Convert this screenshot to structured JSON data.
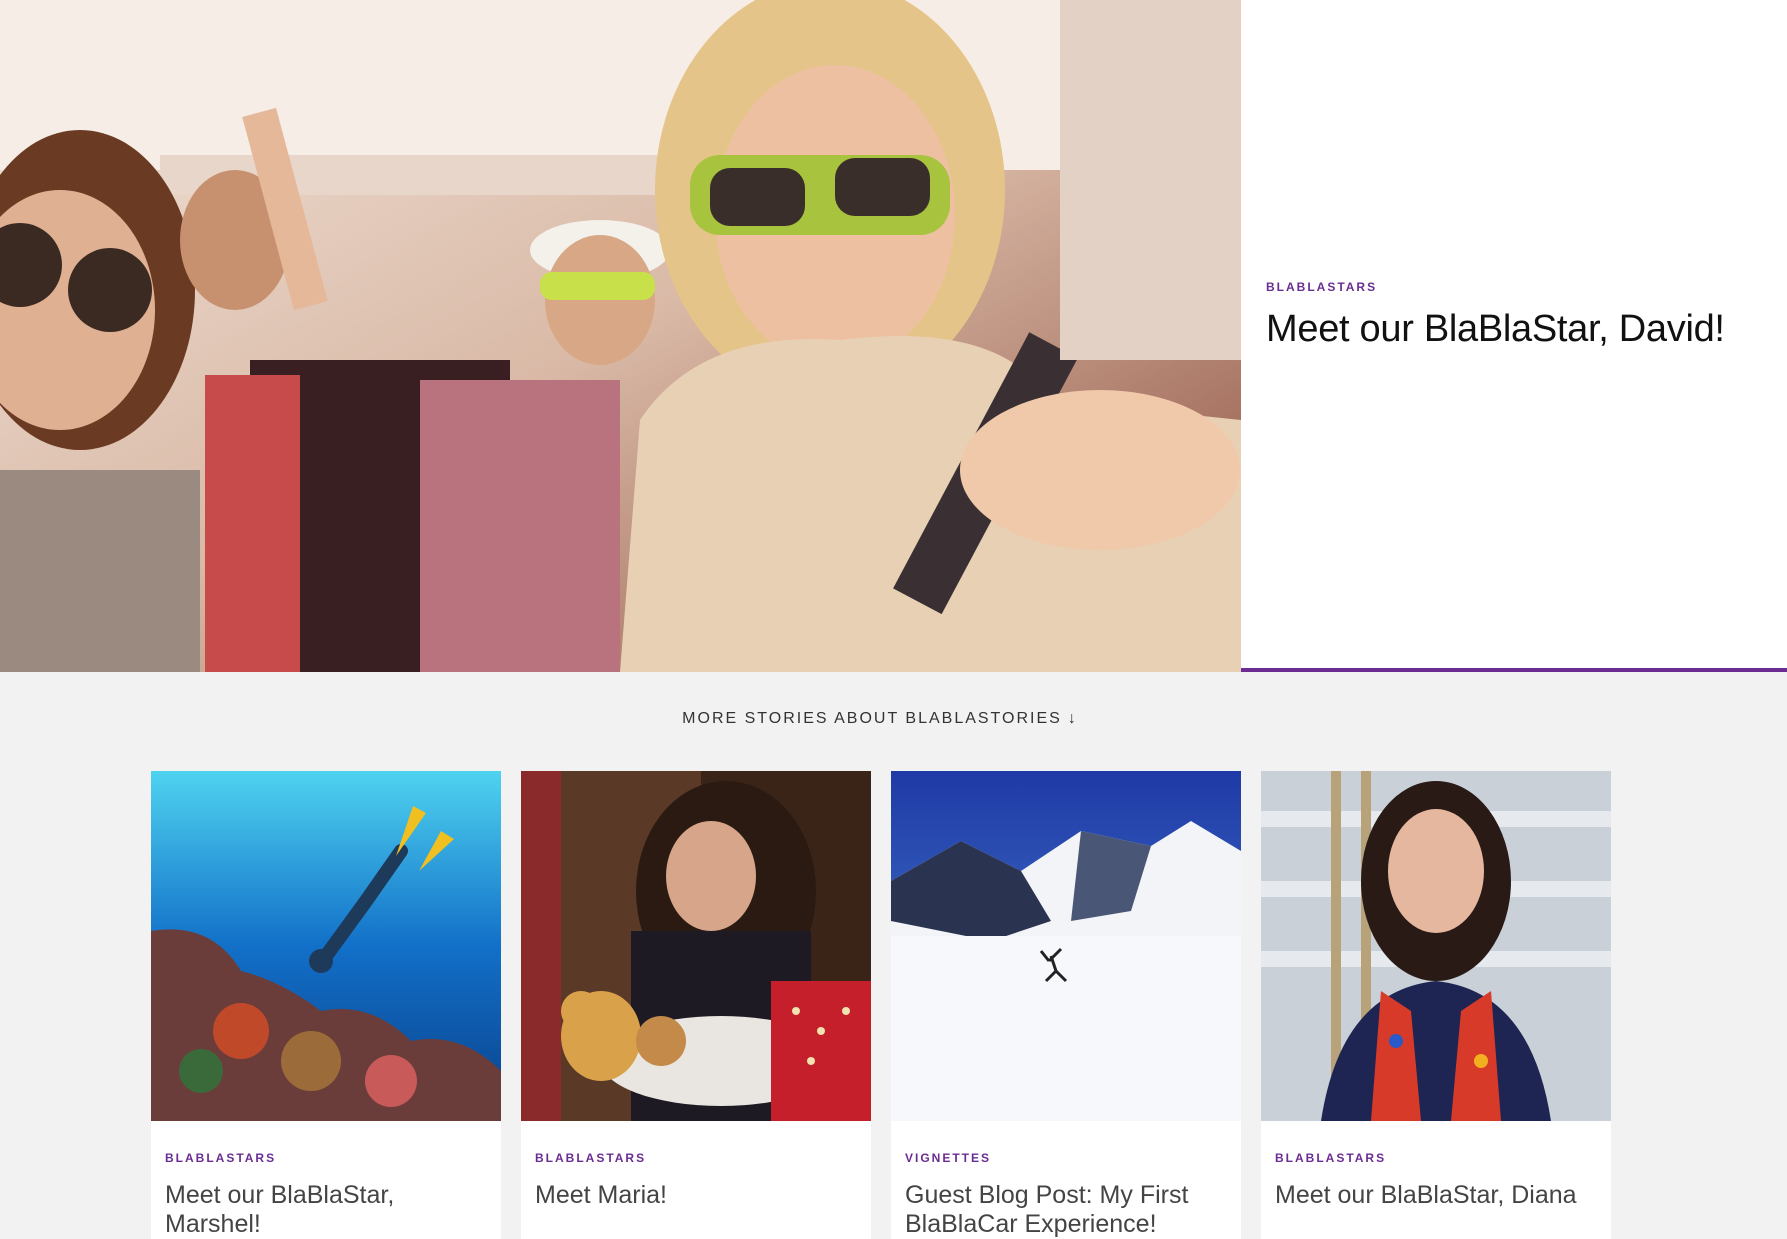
{
  "colors": {
    "accent": "#6b2d91",
    "background": "#f2f2f2"
  },
  "hero": {
    "image": "carpool-selfie-photo",
    "category": "BLABLASTARS",
    "title": "Meet our BlaBlaStar, David!"
  },
  "more": {
    "label": "MORE STORIES ABOUT BLABLASTORIES",
    "arrow_icon": "arrow-down-icon",
    "arrow": "↓"
  },
  "cards": [
    {
      "image": "underwater-diver-photo",
      "category": "BLABLASTARS",
      "title": "Meet our BlaBlaStar, Marshel!"
    },
    {
      "image": "girl-with-teddy-bear-photo",
      "category": "BLABLASTARS",
      "title": "Meet Maria!"
    },
    {
      "image": "snowy-mountains-photo",
      "category": "VIGNETTES",
      "title": "Guest Blog Post: My First BlaBlaCar Experience!"
    },
    {
      "image": "woman-portrait-photo",
      "category": "BLABLASTARS",
      "title": "Meet our BlaBlaStar, Diana"
    }
  ]
}
